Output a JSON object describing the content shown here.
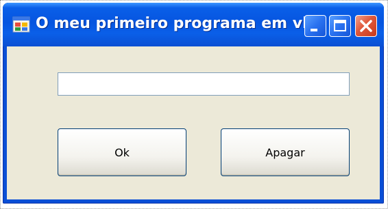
{
  "window": {
    "title": "O meu primeiro programa em vb",
    "controls": {
      "minimize": "minimize-icon",
      "maximize": "maximize-icon",
      "close": "close-icon"
    },
    "app_icon": "form-app-icon"
  },
  "form": {
    "textbox": {
      "value": "",
      "placeholder": ""
    },
    "ok_label": "Ok",
    "clear_label": "Apagar"
  },
  "colors": {
    "titlebar": "#0a5fe8",
    "client_bg": "#ece9d8",
    "close_button": "#e0573a"
  }
}
